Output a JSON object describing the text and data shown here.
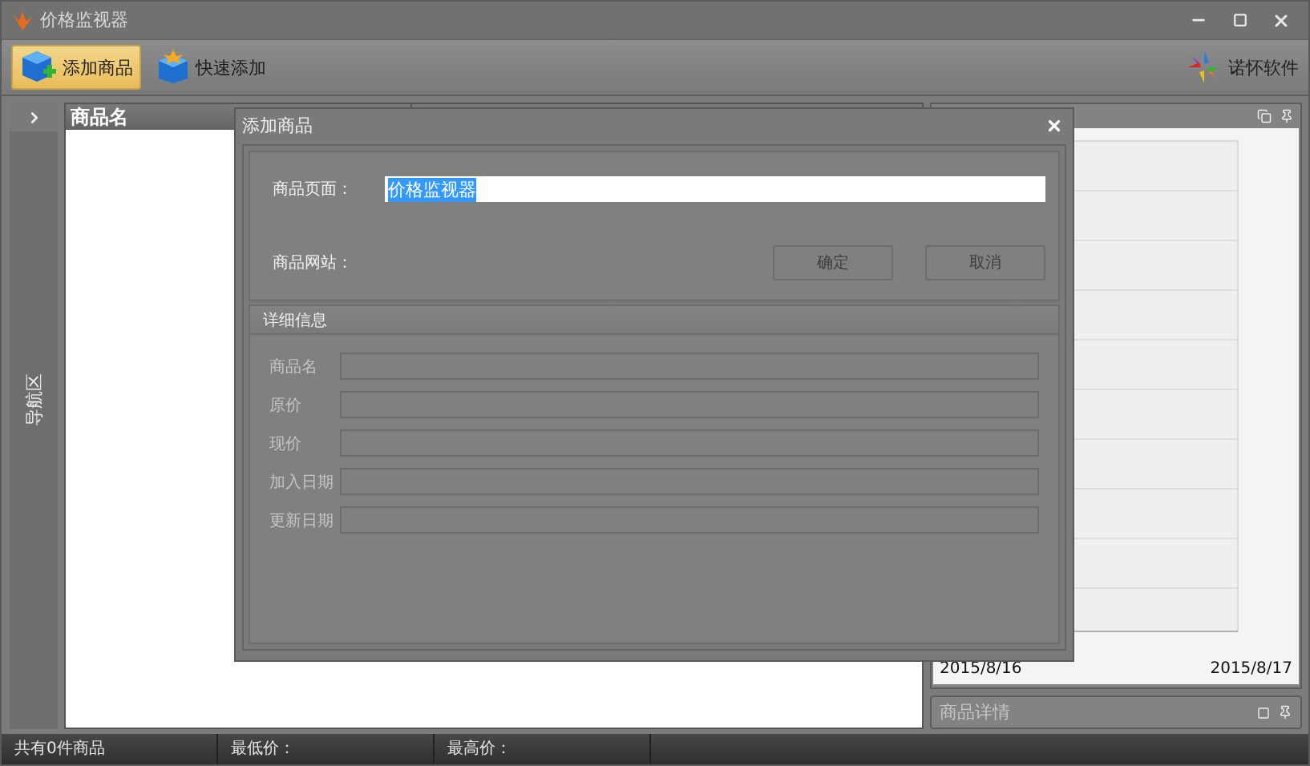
{
  "window": {
    "title": "价格监视器",
    "controls": [
      {
        "kind": "minimize"
      },
      {
        "kind": "maximize"
      },
      {
        "kind": "close"
      }
    ]
  },
  "toolbar": {
    "buttons": [
      {
        "label": "添加商品",
        "selected": true,
        "kind": "box-plus"
      },
      {
        "label": "快速添加",
        "selected": false,
        "kind": "box-star"
      }
    ],
    "brand": "诺怀软件"
  },
  "nav": {
    "label": "导航区"
  },
  "table": {
    "columns": [
      "商品名"
    ]
  },
  "chart_panel": {
    "x_labels": [
      "2015/8/16",
      "2015/8/17"
    ]
  },
  "details_panel": {
    "title": "商品详情"
  },
  "status_bar": [
    "共有0件商品",
    "最低价：",
    "最高价："
  ],
  "dialog": {
    "title": "添加商品",
    "fields": [
      {
        "label": "商品页面：",
        "value": "价格监视器",
        "value_selected": true
      },
      {
        "label": "商品网站："
      }
    ],
    "buttons": [
      {
        "label": "确定",
        "disabled": true
      },
      {
        "label": "取消",
        "disabled": true
      }
    ],
    "details": {
      "title": "详细信息",
      "fields": [
        {
          "label": "商品名",
          "disabled": true
        },
        {
          "label": "原价",
          "disabled": true
        },
        {
          "label": "现价",
          "disabled": true
        },
        {
          "label": "加入日期",
          "disabled": true
        },
        {
          "label": "更新日期",
          "disabled": true
        }
      ]
    }
  }
}
